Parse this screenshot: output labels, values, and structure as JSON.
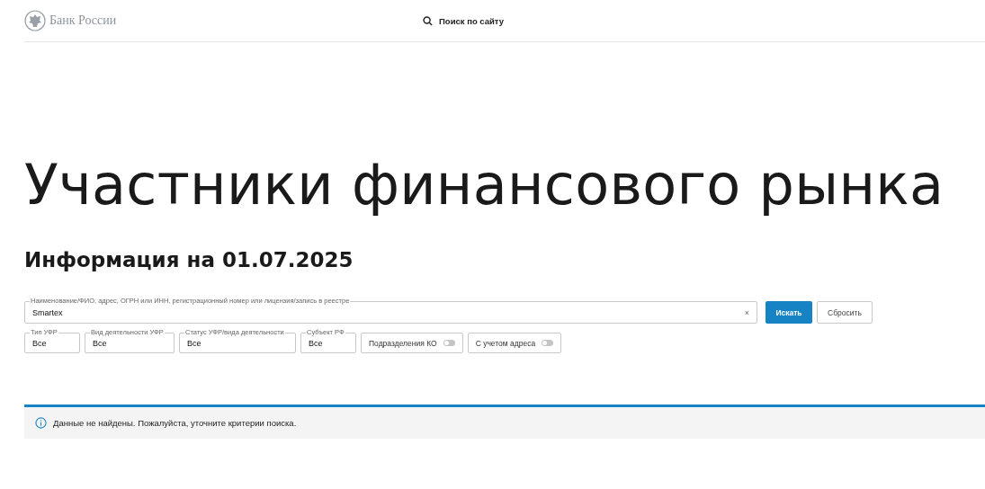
{
  "header": {
    "logo_text": "Банк России",
    "search_label": "Поиск по сайту"
  },
  "title": "Участники финансового рынка",
  "subtitle": "Информация на 01.07.2025",
  "search": {
    "legend": "Наименование/ФИО, адрес, ОГРН или ИНН, регистрационный номер или лицензия/запись в реестре",
    "value": "Smartex",
    "clear": "×"
  },
  "buttons": [
    {
      "label": "Искать",
      "kind": "primary"
    },
    {
      "label": "Сбросить",
      "kind": "secondary"
    }
  ],
  "filters": [
    {
      "kind": "select",
      "legend": "Тип УФР",
      "value": "Все"
    },
    {
      "kind": "select",
      "legend": "Вид деятельности УФР",
      "value": "Все"
    },
    {
      "kind": "select",
      "legend": "Статус УФР/вида деятельности",
      "value": "Все"
    },
    {
      "kind": "select",
      "legend": "Субъект РФ",
      "value": "Все"
    },
    {
      "kind": "toggle",
      "label": "Подразделения КО",
      "on": false
    },
    {
      "kind": "toggle",
      "label": "С учетом адреса",
      "on": false
    }
  ],
  "notice": "Данные не найдены. Пожалуйста, уточните критерии поиска."
}
